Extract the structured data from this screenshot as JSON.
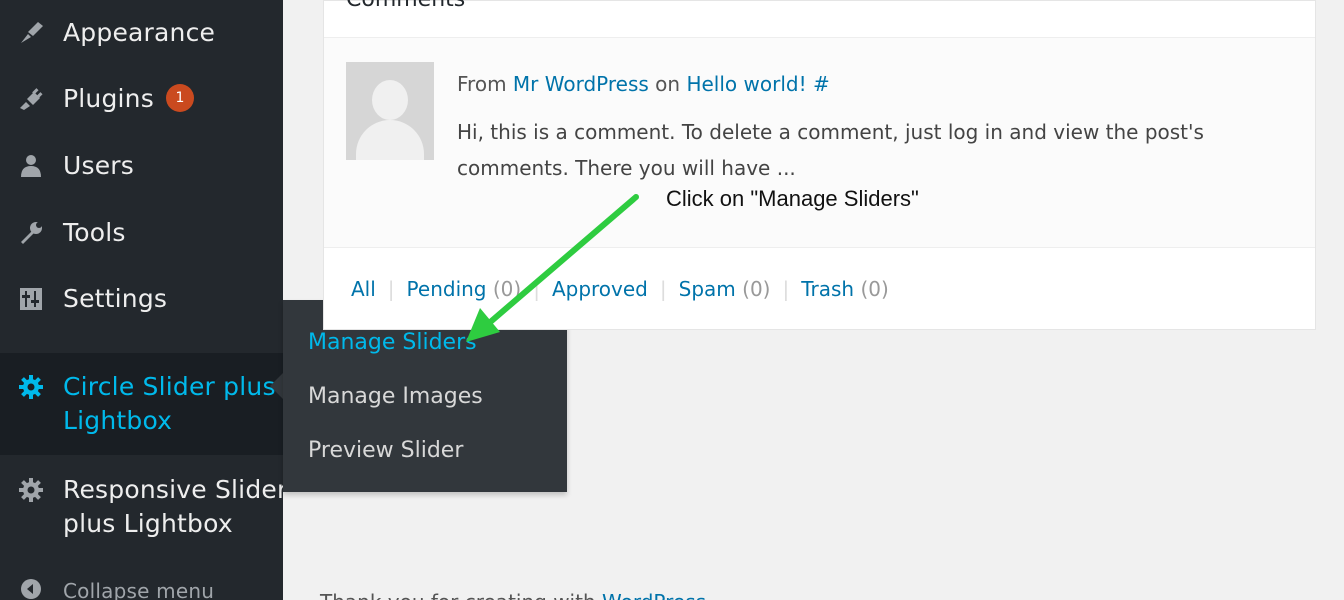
{
  "sidebar": {
    "items": [
      {
        "label": "Appearance",
        "icon": "paintbrush-icon"
      },
      {
        "label": "Plugins",
        "icon": "plugin-icon",
        "badge": "1"
      },
      {
        "label": "Users",
        "icon": "users-icon"
      },
      {
        "label": "Tools",
        "icon": "wrench-icon"
      },
      {
        "label": "Settings",
        "icon": "settings-icon"
      },
      {
        "label_line1": "Circle Slider plus",
        "label_line2": "Lightbox",
        "icon": "gear-icon",
        "active": true
      },
      {
        "label_line1": "Responsive Slider",
        "label_line2": "plus Lightbox",
        "icon": "gear-icon"
      }
    ],
    "collapse_label": "Collapse menu"
  },
  "flyout": {
    "items": [
      {
        "label": "Manage Sliders",
        "active": true
      },
      {
        "label": "Manage Images"
      },
      {
        "label": "Preview Slider"
      }
    ]
  },
  "panel": {
    "title": "Comments",
    "comment": {
      "from_prefix": "From",
      "author": "Mr WordPress",
      "on_word": "on",
      "post": "Hello world! #",
      "text": "Hi, this is a comment. To delete a comment, just log in and view the post's comments. There you will have ..."
    },
    "filters": [
      {
        "label": "All",
        "count": ""
      },
      {
        "label": "Pending",
        "count": "(0)"
      },
      {
        "label": "Approved",
        "count": ""
      },
      {
        "label": "Spam",
        "count": "(0)"
      },
      {
        "label": "Trash",
        "count": "(0)"
      }
    ]
  },
  "annotation": {
    "text": "Click on \"Manage Sliders\"",
    "arrow_color": "#2ecc40"
  },
  "footer": {
    "text_prefix": "Thank you for creating with",
    "link": "WordPress."
  },
  "colors": {
    "sidebar_bg": "#23282d",
    "accent": "#00b9eb",
    "link": "#0073aa",
    "badge": "#ca4a1f"
  }
}
